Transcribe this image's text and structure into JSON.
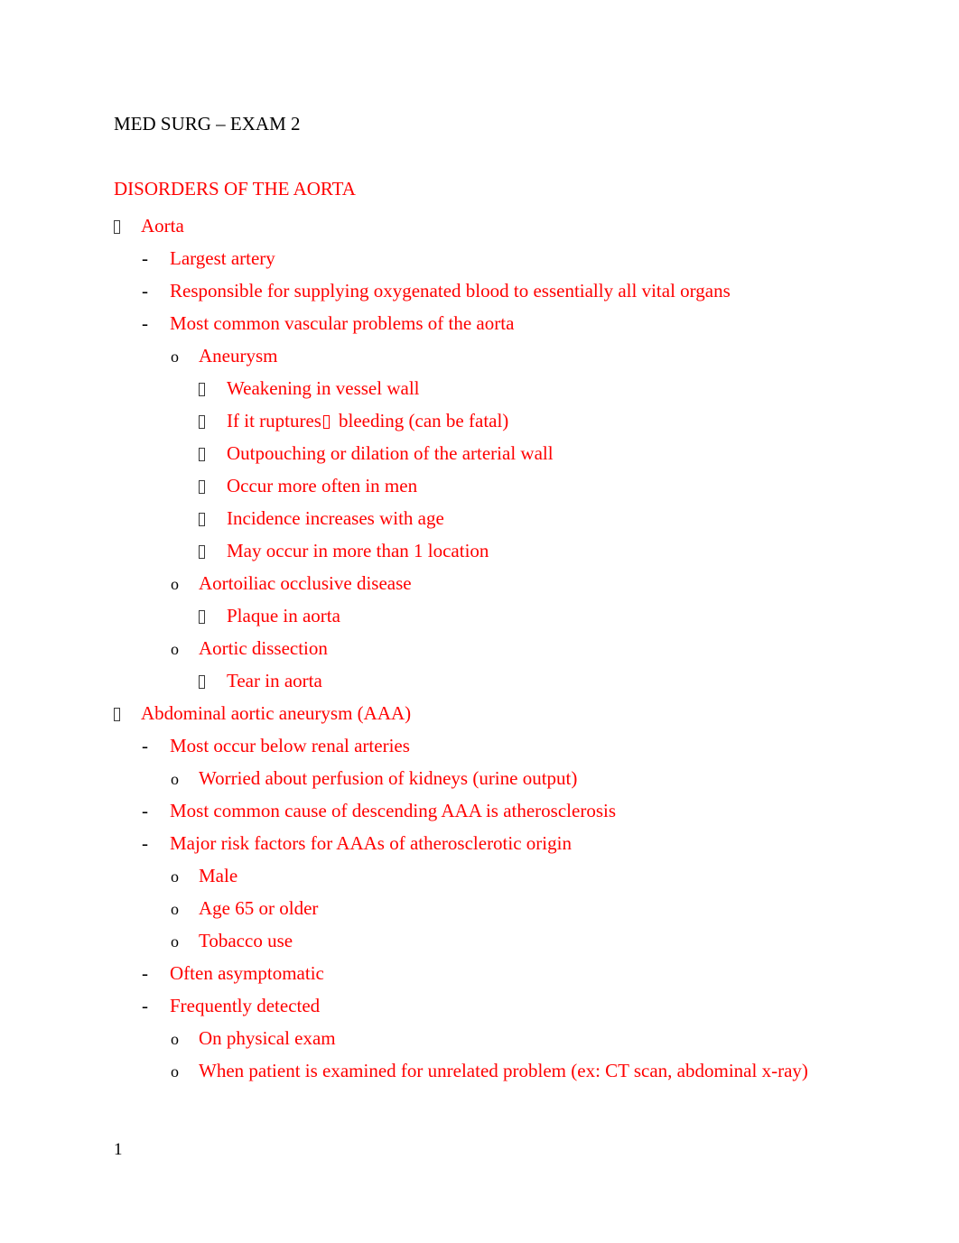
{
  "document": {
    "title": "MED SURG – EXAM 2",
    "section_heading": "DISORDERS OF THE AORTA",
    "page_number": "1",
    "text_color": "#ff0000",
    "title_color": "#000000",
    "marker_color": "#000000",
    "background_color": "#ffffff"
  },
  "markers": {
    "level1": "□",
    "level2": "-",
    "level3": "o",
    "level4": "□",
    "inline_arrow": "□"
  },
  "outline": [
    {
      "level": 1,
      "marker": "tofu",
      "text": "Aorta"
    },
    {
      "level": 2,
      "marker": "hyphen",
      "text": "Largest artery"
    },
    {
      "level": 2,
      "marker": "hyphen",
      "text": "Responsible for supplying oxygenated blood to essentially all vital organs"
    },
    {
      "level": 2,
      "marker": "hyphen",
      "text": "Most common vascular problems of the aorta"
    },
    {
      "level": 3,
      "marker": "o",
      "text": "Aneurysm"
    },
    {
      "level": 4,
      "marker": "tofu",
      "text": "Weakening in vessel wall"
    },
    {
      "level": 4,
      "marker": "tofu",
      "text": "If it ruptures □ bleeding (can be fatal)",
      "text_before": "If it ruptures",
      "has_inline_tofu": true,
      "text_after": "bleeding (can be fatal)"
    },
    {
      "level": 4,
      "marker": "tofu",
      "text": "Outpouching or dilation of the arterial wall"
    },
    {
      "level": 4,
      "marker": "tofu",
      "text": "Occur more often in men"
    },
    {
      "level": 4,
      "marker": "tofu",
      "text": "Incidence increases with age"
    },
    {
      "level": 4,
      "marker": "tofu",
      "text": "May occur in more than 1 location"
    },
    {
      "level": 3,
      "marker": "o",
      "text": "Aortoiliac occlusive disease"
    },
    {
      "level": 4,
      "marker": "tofu",
      "text": "Plaque in aorta"
    },
    {
      "level": 3,
      "marker": "o",
      "text": "Aortic dissection"
    },
    {
      "level": 4,
      "marker": "tofu",
      "text": "Tear in aorta"
    },
    {
      "level": 1,
      "marker": "tofu",
      "text": "Abdominal aortic aneurysm (AAA)"
    },
    {
      "level": 2,
      "marker": "hyphen",
      "text": "Most occur below renal arteries"
    },
    {
      "level": 3,
      "marker": "o",
      "text": "Worried about perfusion of kidneys (urine output)"
    },
    {
      "level": 2,
      "marker": "hyphen",
      "text": "Most common cause of descending AAA is atherosclerosis"
    },
    {
      "level": 2,
      "marker": "hyphen",
      "text": "Major risk factors for AAAs of atherosclerotic origin"
    },
    {
      "level": 3,
      "marker": "o",
      "text": "Male"
    },
    {
      "level": 3,
      "marker": "o",
      "text": "Age 65 or older"
    },
    {
      "level": 3,
      "marker": "o",
      "text": "Tobacco use"
    },
    {
      "level": 2,
      "marker": "hyphen",
      "text": "Often asymptomatic"
    },
    {
      "level": 2,
      "marker": "hyphen",
      "text": "Frequently detected"
    },
    {
      "level": 3,
      "marker": "o",
      "text": "On physical exam"
    },
    {
      "level": 3,
      "marker": "o",
      "text": "When patient is examined for unrelated problem (ex: CT scan, abdominal x-ray)"
    }
  ]
}
